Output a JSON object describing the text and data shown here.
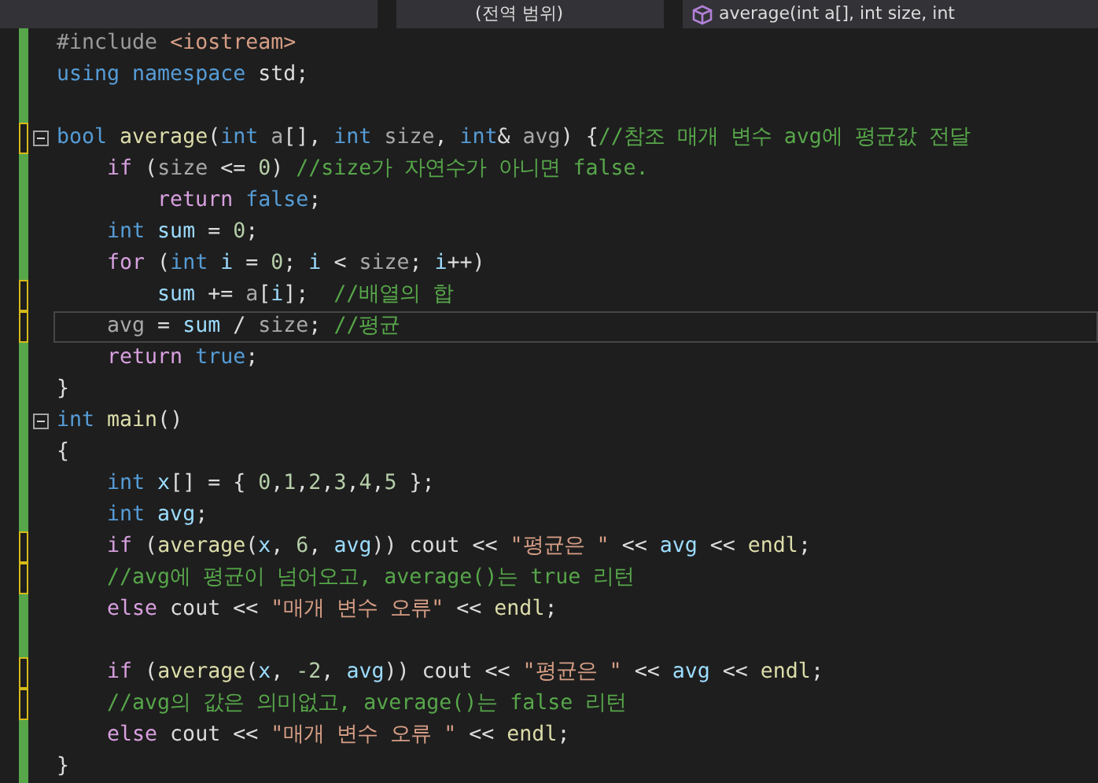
{
  "navigation_bar": {
    "scope": "(전역 범위)",
    "member": "average(int a[], int size, int"
  },
  "lines": [
    {
      "unsaved": false,
      "current": false,
      "foldable": false,
      "tokens": [
        {
          "kind": "preproc",
          "text": "#include "
        },
        {
          "kind": "string",
          "text": "<iostream>"
        }
      ]
    },
    {
      "unsaved": false,
      "current": false,
      "foldable": false,
      "tokens": [
        {
          "kind": "keyword",
          "text": "using"
        },
        {
          "kind": "keyword",
          "text": " namespace"
        },
        {
          "kind": "plain",
          "text": " std;"
        }
      ]
    },
    {
      "unsaved": false,
      "current": false,
      "foldable": false
    },
    {
      "unsaved": true,
      "current": false,
      "foldable": true,
      "tokens": [
        {
          "kind": "keyword",
          "text": "bool"
        },
        {
          "kind": "function",
          "text": " average"
        },
        {
          "kind": "plain",
          "text": "("
        },
        {
          "kind": "keyword",
          "text": "int"
        },
        {
          "kind": "param",
          "text": " a"
        },
        {
          "kind": "plain",
          "text": "[], "
        },
        {
          "kind": "keyword",
          "text": "int"
        },
        {
          "kind": "param",
          "text": " size"
        },
        {
          "kind": "plain",
          "text": ", "
        },
        {
          "kind": "keyword",
          "text": "int"
        },
        {
          "kind": "plain",
          "text": "& "
        },
        {
          "kind": "param",
          "text": "avg"
        },
        {
          "kind": "plain",
          "text": ") {"
        },
        {
          "kind": "comment",
          "text": "//참조 매개 변수 avg에 평균값 전달"
        }
      ]
    },
    {
      "unsaved": false,
      "current": false,
      "foldable": false,
      "tokens": [
        {
          "kind": "control",
          "text": "    if"
        },
        {
          "kind": "plain",
          "text": " ("
        },
        {
          "kind": "param",
          "text": "size"
        },
        {
          "kind": "plain",
          "text": " <= "
        },
        {
          "kind": "number",
          "text": "0"
        },
        {
          "kind": "plain",
          "text": ") "
        },
        {
          "kind": "comment",
          "text": "//size가 자연수가 아니면 false."
        }
      ]
    },
    {
      "unsaved": false,
      "current": false,
      "foldable": false,
      "tokens": [
        {
          "kind": "control",
          "text": "        return"
        },
        {
          "kind": "keyword",
          "text": " false"
        },
        {
          "kind": "plain",
          "text": ";"
        }
      ]
    },
    {
      "unsaved": false,
      "current": false,
      "foldable": false,
      "tokens": [
        {
          "kind": "keyword",
          "text": "    int"
        },
        {
          "kind": "variable",
          "text": " sum"
        },
        {
          "kind": "plain",
          "text": " = "
        },
        {
          "kind": "number",
          "text": "0"
        },
        {
          "kind": "plain",
          "text": ";"
        }
      ]
    },
    {
      "unsaved": false,
      "current": false,
      "foldable": false,
      "tokens": [
        {
          "kind": "control",
          "text": "    for"
        },
        {
          "kind": "plain",
          "text": " ("
        },
        {
          "kind": "keyword",
          "text": "int"
        },
        {
          "kind": "variable",
          "text": " i"
        },
        {
          "kind": "plain",
          "text": " = "
        },
        {
          "kind": "number",
          "text": "0"
        },
        {
          "kind": "plain",
          "text": "; "
        },
        {
          "kind": "variable",
          "text": "i"
        },
        {
          "kind": "plain",
          "text": " < "
        },
        {
          "kind": "param",
          "text": "size"
        },
        {
          "kind": "plain",
          "text": "; "
        },
        {
          "kind": "variable",
          "text": "i"
        },
        {
          "kind": "plain",
          "text": "++)"
        }
      ]
    },
    {
      "unsaved": true,
      "current": false,
      "foldable": false,
      "tokens": [
        {
          "kind": "variable",
          "text": "        sum"
        },
        {
          "kind": "plain",
          "text": " += "
        },
        {
          "kind": "param",
          "text": "a"
        },
        {
          "kind": "plain",
          "text": "["
        },
        {
          "kind": "variable",
          "text": "i"
        },
        {
          "kind": "plain",
          "text": "];  "
        },
        {
          "kind": "comment",
          "text": "//배열의 합"
        }
      ]
    },
    {
      "unsaved": true,
      "current": true,
      "foldable": false,
      "tokens": [
        {
          "kind": "param",
          "text": "    avg"
        },
        {
          "kind": "plain",
          "text": " = "
        },
        {
          "kind": "variable",
          "text": "sum"
        },
        {
          "kind": "plain",
          "text": " / "
        },
        {
          "kind": "param",
          "text": "size"
        },
        {
          "kind": "plain",
          "text": "; "
        },
        {
          "kind": "comment",
          "text": "//평균"
        }
      ]
    },
    {
      "unsaved": false,
      "current": false,
      "foldable": false,
      "tokens": [
        {
          "kind": "control",
          "text": "    return"
        },
        {
          "kind": "keyword",
          "text": " true"
        },
        {
          "kind": "plain",
          "text": ";"
        }
      ]
    },
    {
      "unsaved": false,
      "current": false,
      "foldable": false,
      "tokens": [
        {
          "kind": "plain",
          "text": "}"
        }
      ]
    },
    {
      "unsaved": false,
      "current": false,
      "foldable": true,
      "tokens": [
        {
          "kind": "keyword",
          "text": "int"
        },
        {
          "kind": "function",
          "text": " main"
        },
        {
          "kind": "plain",
          "text": "()"
        }
      ]
    },
    {
      "unsaved": false,
      "current": false,
      "foldable": false,
      "tokens": [
        {
          "kind": "plain",
          "text": "{"
        }
      ]
    },
    {
      "unsaved": false,
      "current": false,
      "foldable": false,
      "tokens": [
        {
          "kind": "keyword",
          "text": "    int"
        },
        {
          "kind": "variable",
          "text": " x"
        },
        {
          "kind": "plain",
          "text": "[] = { "
        },
        {
          "kind": "number",
          "text": "0"
        },
        {
          "kind": "plain",
          "text": ","
        },
        {
          "kind": "number",
          "text": "1"
        },
        {
          "kind": "plain",
          "text": ","
        },
        {
          "kind": "number",
          "text": "2"
        },
        {
          "kind": "plain",
          "text": ","
        },
        {
          "kind": "number",
          "text": "3"
        },
        {
          "kind": "plain",
          "text": ","
        },
        {
          "kind": "number",
          "text": "4"
        },
        {
          "kind": "plain",
          "text": ","
        },
        {
          "kind": "number",
          "text": "5"
        },
        {
          "kind": "plain",
          "text": " };"
        }
      ]
    },
    {
      "unsaved": false,
      "current": false,
      "foldable": false,
      "tokens": [
        {
          "kind": "keyword",
          "text": "    int"
        },
        {
          "kind": "variable",
          "text": " avg"
        },
        {
          "kind": "plain",
          "text": ";"
        }
      ]
    },
    {
      "unsaved": true,
      "current": false,
      "foldable": false,
      "tokens": [
        {
          "kind": "control",
          "text": "    if"
        },
        {
          "kind": "plain",
          "text": " ("
        },
        {
          "kind": "function",
          "text": "average"
        },
        {
          "kind": "plain",
          "text": "("
        },
        {
          "kind": "variable",
          "text": "x"
        },
        {
          "kind": "plain",
          "text": ", "
        },
        {
          "kind": "number",
          "text": "6"
        },
        {
          "kind": "plain",
          "text": ", "
        },
        {
          "kind": "variable",
          "text": "avg"
        },
        {
          "kind": "plain",
          "text": ")) cout << "
        },
        {
          "kind": "string",
          "text": "\"평균은 \""
        },
        {
          "kind": "plain",
          "text": " << "
        },
        {
          "kind": "variable",
          "text": "avg"
        },
        {
          "kind": "plain",
          "text": " << "
        },
        {
          "kind": "function",
          "text": "endl"
        },
        {
          "kind": "plain",
          "text": ";"
        }
      ]
    },
    {
      "unsaved": true,
      "current": false,
      "foldable": false,
      "tokens": [
        {
          "kind": "comment",
          "text": "    //avg에 평균이 넘어오고, average()는 true 리턴"
        }
      ]
    },
    {
      "unsaved": false,
      "current": false,
      "foldable": false,
      "tokens": [
        {
          "kind": "control",
          "text": "    else"
        },
        {
          "kind": "plain",
          "text": " cout << "
        },
        {
          "kind": "string",
          "text": "\"매개 변수 오류\""
        },
        {
          "kind": "plain",
          "text": " << "
        },
        {
          "kind": "function",
          "text": "endl"
        },
        {
          "kind": "plain",
          "text": ";"
        }
      ]
    },
    {
      "unsaved": false,
      "current": false,
      "foldable": false
    },
    {
      "unsaved": true,
      "current": false,
      "foldable": false,
      "tokens": [
        {
          "kind": "control",
          "text": "    if"
        },
        {
          "kind": "plain",
          "text": " ("
        },
        {
          "kind": "function",
          "text": "average"
        },
        {
          "kind": "plain",
          "text": "("
        },
        {
          "kind": "variable",
          "text": "x"
        },
        {
          "kind": "plain",
          "text": ", "
        },
        {
          "kind": "number",
          "text": "-2"
        },
        {
          "kind": "plain",
          "text": ", "
        },
        {
          "kind": "variable",
          "text": "avg"
        },
        {
          "kind": "plain",
          "text": ")) cout << "
        },
        {
          "kind": "string",
          "text": "\"평균은 \""
        },
        {
          "kind": "plain",
          "text": " << "
        },
        {
          "kind": "variable",
          "text": "avg"
        },
        {
          "kind": "plain",
          "text": " << "
        },
        {
          "kind": "function",
          "text": "endl"
        },
        {
          "kind": "plain",
          "text": ";"
        }
      ]
    },
    {
      "unsaved": true,
      "current": false,
      "foldable": false,
      "tokens": [
        {
          "kind": "comment",
          "text": "    //avg의 값은 의미없고, average()는 false 리턴"
        }
      ]
    },
    {
      "unsaved": false,
      "current": false,
      "foldable": false,
      "tokens": [
        {
          "kind": "control",
          "text": "    else"
        },
        {
          "kind": "plain",
          "text": " cout << "
        },
        {
          "kind": "string",
          "text": "\"매개 변수 오류 \""
        },
        {
          "kind": "plain",
          "text": " << "
        },
        {
          "kind": "function",
          "text": "endl"
        },
        {
          "kind": "plain",
          "text": ";"
        }
      ]
    },
    {
      "unsaved": false,
      "current": false,
      "foldable": false,
      "tokens": [
        {
          "kind": "plain",
          "text": "}"
        }
      ]
    }
  ]
}
